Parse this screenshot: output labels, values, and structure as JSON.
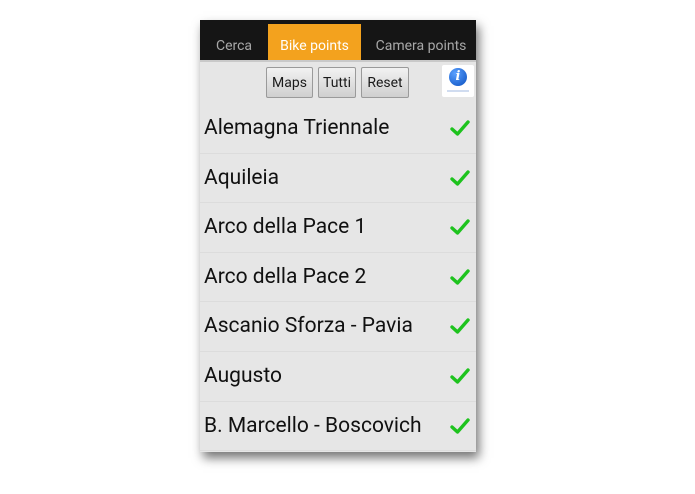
{
  "tabs": [
    {
      "label": "Cerca",
      "active": false
    },
    {
      "label": "Bike points",
      "active": true
    },
    {
      "label": "Camera points",
      "active": false
    }
  ],
  "toolbar": {
    "maps_label": "Maps",
    "tutti_label": "Tutti",
    "reset_label": "Reset",
    "info_glyph": "i"
  },
  "list": {
    "items": [
      {
        "label": "Alemagna Triennale",
        "checked": true
      },
      {
        "label": "Aquileia",
        "checked": true
      },
      {
        "label": "Arco della Pace 1",
        "checked": true
      },
      {
        "label": "Arco della Pace 2",
        "checked": true
      },
      {
        "label": "Ascanio Sforza - Pavia",
        "checked": true
      },
      {
        "label": "Augusto",
        "checked": true
      },
      {
        "label": "B. Marcello - Boscovich",
        "checked": true
      }
    ]
  },
  "colors": {
    "active_tab": "#f3a21e",
    "tab_bar": "#151515",
    "check": "#1ec31e",
    "list_background": "#e6e6e6"
  },
  "icons": {
    "check": "check-icon",
    "info": "info-icon"
  }
}
